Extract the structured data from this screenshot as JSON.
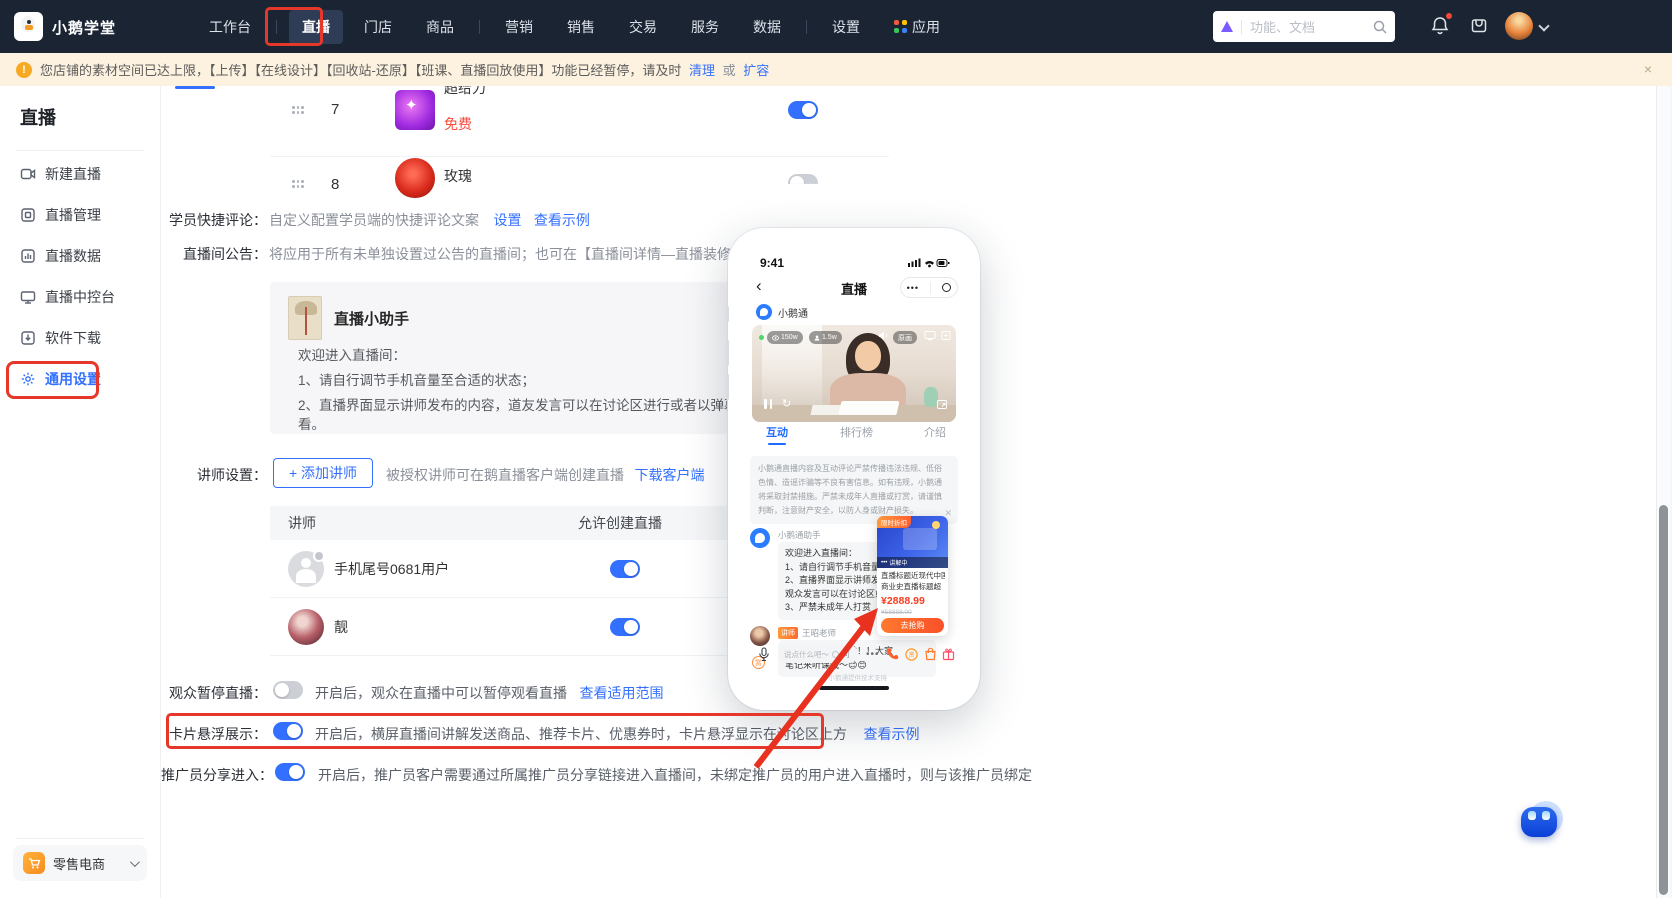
{
  "colors": {
    "accent": "#3370ff",
    "annotation_red": "#e6382a",
    "nav_bg": "#1a2433",
    "banner_bg": "#fcf2df",
    "toggle_on": "#3370ff",
    "price_red": "#fa3c1e",
    "btn_orange": "#ff5e2c"
  },
  "nav": {
    "brand": "小鹅学堂",
    "items": [
      "工作台",
      "直播",
      "门店",
      "商品",
      "营销",
      "销售",
      "交易",
      "服务",
      "数据",
      "设置",
      "应用"
    ],
    "active": "直播",
    "search_placeholder": "功能、文档"
  },
  "banner": {
    "text": "您店铺的素材空间已达上限，【上传】【在线设计】【回收站-还原】【班课、直播回放使用】功能已经暂停，请及时",
    "link_clean": "清理",
    "or": "或",
    "link_expand": "扩容",
    "close": "×"
  },
  "sidebar": {
    "title": "直播",
    "items": [
      "新建直播",
      "直播管理",
      "直播数据",
      "直播中控台",
      "软件下载",
      "通用设置"
    ],
    "active": "通用设置",
    "workspace": "零售电商"
  },
  "content": {
    "gifts": {
      "row7": {
        "order": "7",
        "name": "超给力",
        "price": "免费",
        "enabled": true
      },
      "row8": {
        "order": "8",
        "name": "玫瑰",
        "enabled": false
      }
    },
    "quick_comment": {
      "label": "学员快捷评论：",
      "desc": "自定义配置学员端的快捷评论文案",
      "link_set": "设置",
      "link_example": "查看示例"
    },
    "announcement": {
      "label": "直播间公告：",
      "desc": "将应用于所有未单独设置过公告的直播间；也可在【直播间详情—直播装修-直",
      "card_title": "直播小助手",
      "lines": [
        "欢迎进入直播间：",
        "1、请自行调节手机音量至合适的状态；",
        "2、直播界面显示讲师发布的内容，道友发言可以在讨论区进行或者以弹幕形",
        "看。"
      ]
    },
    "lecturer": {
      "label": "讲师设置：",
      "add_button": "+ 添加讲师",
      "desc": "被授权讲师可在鹅直播客户端创建直播",
      "download_link": "下载客户端",
      "col_name": "讲师",
      "col_allow": "允许创建直播",
      "rows": [
        {
          "name": "手机尾号0681用户",
          "allow": true
        },
        {
          "name": "靓",
          "allow": true
        }
      ]
    },
    "pause": {
      "label": "观众暂停直播：",
      "enabled": false,
      "desc": "开启后，观众在直播中可以暂停观看直播",
      "link": "查看适用范围"
    },
    "card_float": {
      "label": "卡片悬浮展示：",
      "enabled": true,
      "desc": "开启后，横屏直播间讲解发送商品、推荐卡片、优惠券时，卡片悬浮显示在讨论区上方",
      "link": "查看示例"
    },
    "promoter": {
      "label": "推广员分享进入：",
      "enabled": true,
      "desc": "开启后，推广员客户需要通过所属推广员分享链接进入直播间，未绑定推广员的用户进入直播时，则与该推广员绑定"
    }
  },
  "phone": {
    "time": "9:41",
    "nav_title": "直播",
    "channel": "小鹅通",
    "views": "150w",
    "people": "1.5w",
    "quality": "原画",
    "tabs": [
      "互动",
      "排行榜",
      "介绍"
    ],
    "notice_lines": [
      "小鹅通直播内容及互动评论严禁传播违法违规、低俗",
      "色情、造谣诈骗等不良有害信息。如有违规，小鹅通",
      "将采取封禁措施。严禁未成年人直播或打赏，请谨慎",
      "判断，注意财产安全，以防人身或财产损失。"
    ],
    "assistant": {
      "name": "小鹅通助手",
      "lines": [
        "欢迎进入直播间：",
        "1、请自行调节手机音量至",
        "2、直播界面显示讲师发布",
        "观众发言可以在讨论区或",
        "3、严禁未成年人打赏"
      ]
    },
    "teacher": {
      "badge": "讲师",
      "name": "王昭老师",
      "line1": "老师布置新作业啦！！大家",
      "line2": "笔记来听课哦～😊😊",
      "reward": "赏"
    },
    "product": {
      "badge": "限时折扣",
      "live_status": "讲解中",
      "title1": "直播标题近现代中国",
      "title2": "商业史直播标题超",
      "price": "¥2888.99",
      "original": "¥58888.00",
      "button": "去抢购"
    },
    "input_placeholder": "说点什么吧～",
    "ask": "问",
    "footer": "小鹅通提供技术支持"
  }
}
